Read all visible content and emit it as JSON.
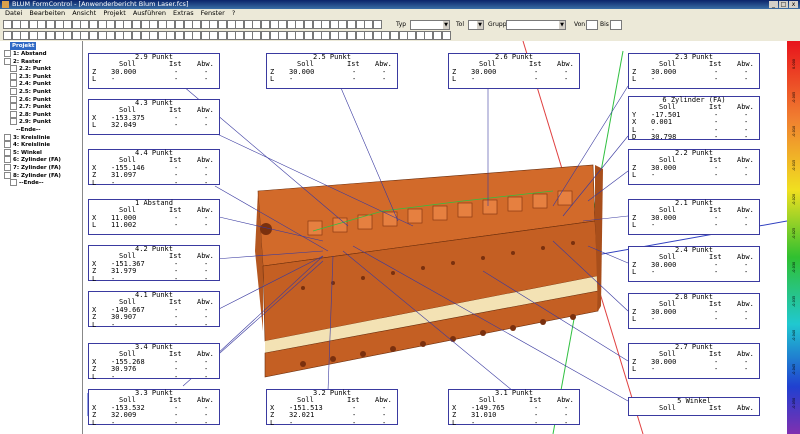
{
  "window": {
    "title": "BLUM FormControl - [Anwenderbericht Blum Laser.fcs]",
    "min": "_",
    "max": "□",
    "close": "x"
  },
  "menu": [
    "Datei",
    "Bearbeiten",
    "Ansicht",
    "Projekt",
    "Ausführen",
    "Extras",
    "Fenster",
    "?"
  ],
  "toolbar": {
    "typ_label": "Typ",
    "tol_label": "Tol",
    "gruppe_label": "Gruppe",
    "von_label": "Von",
    "bis_label": "Bis"
  },
  "tree": {
    "header": "Projekt",
    "items": [
      {
        "label": "1: Abstand",
        "level": 0
      },
      {
        "label": "2: Raster",
        "level": 0
      },
      {
        "label": "2.2: Punkt",
        "level": 1
      },
      {
        "label": "2.3: Punkt",
        "level": 1
      },
      {
        "label": "2.4: Punkt",
        "level": 1
      },
      {
        "label": "2.5: Punkt",
        "level": 1
      },
      {
        "label": "2.6: Punkt",
        "level": 1
      },
      {
        "label": "2.7: Punkt",
        "level": 1
      },
      {
        "label": "2.8: Punkt",
        "level": 1
      },
      {
        "label": "2.9: Punkt",
        "level": 1
      },
      {
        "label": "--Ende--",
        "level": 2
      },
      {
        "label": "3: Kreislinie",
        "level": 0
      },
      {
        "label": "4: Kreislinie",
        "level": 0
      },
      {
        "label": "5: Winkel",
        "level": 0
      },
      {
        "label": "6: Zylinder (FA)",
        "level": 0
      },
      {
        "label": "7: Zylinder (FA)",
        "level": 0
      },
      {
        "label": "8: Zylinder (FA)",
        "level": 0
      },
      {
        "label": "--Ende--",
        "level": 1
      }
    ]
  },
  "colorbar_ticks": [
    "0.000",
    "-0.005",
    "-0.010",
    "-0.015",
    "-0.020",
    "-0.025",
    "-0.030",
    "-0.035",
    "-0.040",
    "-0.045",
    "-0.050"
  ],
  "columns": {
    "soll": "Soll",
    "ist": "Ist",
    "abw": "Abw."
  },
  "boxes": [
    {
      "title": "2.9 Punkt",
      "rows": [
        [
          "Z",
          "30.000",
          "-",
          "-"
        ],
        [
          "L",
          "-",
          "-",
          "-"
        ]
      ]
    },
    {
      "title": "2.5 Punkt",
      "rows": [
        [
          "Z",
          "30.000",
          "-",
          "-"
        ],
        [
          "L",
          "-",
          "-",
          "-"
        ]
      ]
    },
    {
      "title": "2.6 Punkt",
      "rows": [
        [
          "Z",
          "30.000",
          "-",
          "-"
        ],
        [
          "L",
          "-",
          "-",
          "-"
        ]
      ]
    },
    {
      "title": "2.3 Punkt",
      "rows": [
        [
          "Z",
          "30.000",
          "-",
          "-"
        ],
        [
          "L",
          "-",
          "-",
          "-"
        ]
      ]
    },
    {
      "title": "4.3 Punkt",
      "rows": [
        [
          "X",
          "-153.375",
          "-",
          "-"
        ],
        [
          "L",
          "32.049",
          "-",
          "-"
        ]
      ]
    },
    {
      "title": "6 Zylinder (FA)",
      "rows": [
        [
          "Y",
          "-17.501",
          "-",
          "-"
        ],
        [
          "X",
          "0.001",
          "-",
          "-"
        ],
        [
          "L",
          "-",
          "-",
          "-"
        ],
        [
          "D",
          "30.798",
          "-",
          "-"
        ]
      ]
    },
    {
      "title": "4.4 Punkt",
      "rows": [
        [
          "X",
          "-155.146",
          "-",
          "-"
        ],
        [
          "Z",
          "31.097",
          "-",
          "-"
        ],
        [
          "L",
          "-",
          "-",
          "-"
        ]
      ]
    },
    {
      "title": "2.2 Punkt",
      "rows": [
        [
          "Z",
          "30.000",
          "-",
          "-"
        ],
        [
          "L",
          "-",
          "-",
          "-"
        ]
      ]
    },
    {
      "title": "1 Abstand",
      "rows": [
        [
          "X",
          "11.000",
          "-",
          "-"
        ],
        [
          "L",
          "11.002",
          "-",
          "-"
        ]
      ]
    },
    {
      "title": "2.1 Punkt",
      "rows": [
        [
          "Z",
          "30.000",
          "-",
          "-"
        ],
        [
          "L",
          "-",
          "-",
          "-"
        ]
      ]
    },
    {
      "title": "4.2 Punkt",
      "rows": [
        [
          "X",
          "-151.367",
          "-",
          "-"
        ],
        [
          "Z",
          "31.979",
          "-",
          "-"
        ],
        [
          "L",
          "-",
          "-",
          "-"
        ]
      ]
    },
    {
      "title": "2.4 Punkt",
      "rows": [
        [
          "Z",
          "30.000",
          "-",
          "-"
        ],
        [
          "L",
          "-",
          "-",
          "-"
        ]
      ]
    },
    {
      "title": "4.1 Punkt",
      "rows": [
        [
          "X",
          "-149.667",
          "-",
          "-"
        ],
        [
          "Z",
          "30.907",
          "-",
          "-"
        ],
        [
          "L",
          "-",
          "-",
          "-"
        ]
      ]
    },
    {
      "title": "2.8 Punkt",
      "rows": [
        [
          "Z",
          "30.000",
          "-",
          "-"
        ],
        [
          "L",
          "-",
          "-",
          "-"
        ]
      ]
    },
    {
      "title": "3.4 Punkt",
      "rows": [
        [
          "X",
          "-155.268",
          "-",
          "-"
        ],
        [
          "Z",
          "30.976",
          "-",
          "-"
        ],
        [
          "L",
          "-",
          "-",
          "-"
        ]
      ]
    },
    {
      "title": "2.7 Punkt",
      "rows": [
        [
          "Z",
          "30.000",
          "-",
          "-"
        ],
        [
          "L",
          "-",
          "-",
          "-"
        ]
      ]
    },
    {
      "title": "3.3 Punkt",
      "rows": [
        [
          "X",
          "-153.532",
          "-",
          "-"
        ],
        [
          "Z",
          "32.009",
          "-",
          "-"
        ],
        [
          "L",
          "-",
          "-",
          "-"
        ]
      ]
    },
    {
      "title": "3.2 Punkt",
      "rows": [
        [
          "X",
          "-151.513",
          "-",
          "-"
        ],
        [
          "Z",
          "32.021",
          "-",
          "-"
        ],
        [
          "L",
          "-",
          "-",
          "-"
        ]
      ]
    },
    {
      "title": "3.1 Punkt",
      "rows": [
        [
          "X",
          "-149.765",
          "-",
          "-"
        ],
        [
          "Z",
          "31.010",
          "-",
          "-"
        ],
        [
          "L",
          "-",
          "-",
          "-"
        ]
      ]
    },
    {
      "title": "5 Winkel",
      "rows": [
        [
          "",
          "Soll",
          "Ist",
          "Abw."
        ]
      ]
    }
  ]
}
